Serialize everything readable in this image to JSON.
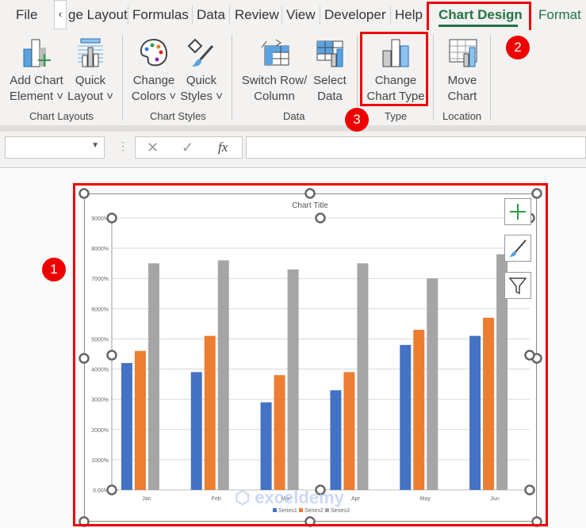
{
  "tabs": [
    {
      "label": "File"
    },
    {
      "label": "ge Layout"
    },
    {
      "label": "Formulas"
    },
    {
      "label": "Data"
    },
    {
      "label": "Review"
    },
    {
      "label": "View"
    },
    {
      "label": "Developer"
    },
    {
      "label": "Help"
    },
    {
      "label": "Chart Design"
    },
    {
      "label": "Format"
    }
  ],
  "scroll_left": "‹",
  "ribbon": {
    "add_chart_element": [
      "Add Chart",
      "Element ˅"
    ],
    "quick_layout": [
      "Quick",
      "Layout ˅"
    ],
    "change_colors": [
      "Change",
      "Colors ˅"
    ],
    "quick_styles": [
      "Quick",
      "Styles ˅"
    ],
    "switch_row_column": [
      "Switch Row/",
      "Column"
    ],
    "select_data": [
      "Select",
      "Data"
    ],
    "change_chart_type": [
      "Change",
      "Chart Type"
    ],
    "move_chart": [
      "Move",
      "Chart"
    ],
    "groups": [
      "Chart Layouts",
      "Chart Styles",
      "Data",
      "Type",
      "Location"
    ]
  },
  "formula_bar": {
    "name_box": "",
    "cancel": "✕",
    "enter": "✓",
    "fx": "fx",
    "value": ""
  },
  "badges": [
    "1",
    "2",
    "3"
  ],
  "accent": "#217346",
  "chart_data": {
    "type": "bar",
    "title": "Chart Title",
    "categories": [
      "Jan",
      "Feb",
      "Mar",
      "Apr",
      "May",
      "Jun"
    ],
    "series": [
      {
        "name": "Series1",
        "color": "#4472c4",
        "values": [
          42,
          39,
          29,
          33,
          48,
          51
        ]
      },
      {
        "name": "Series2",
        "color": "#ed7d31",
        "values": [
          46,
          51,
          38,
          39,
          53,
          57
        ]
      },
      {
        "name": "Series3",
        "color": "#a5a5a5",
        "values": [
          75,
          76,
          73,
          75,
          70,
          78
        ]
      }
    ],
    "yticks": [
      "0.00%",
      "1000%",
      "2000%",
      "3000%",
      "4000%",
      "5000%",
      "6000%",
      "7000%",
      "8000%",
      "9000%"
    ],
    "ylim": [
      0,
      90
    ],
    "grid": true,
    "legend": "bottom"
  },
  "watermark": "exceldemy"
}
